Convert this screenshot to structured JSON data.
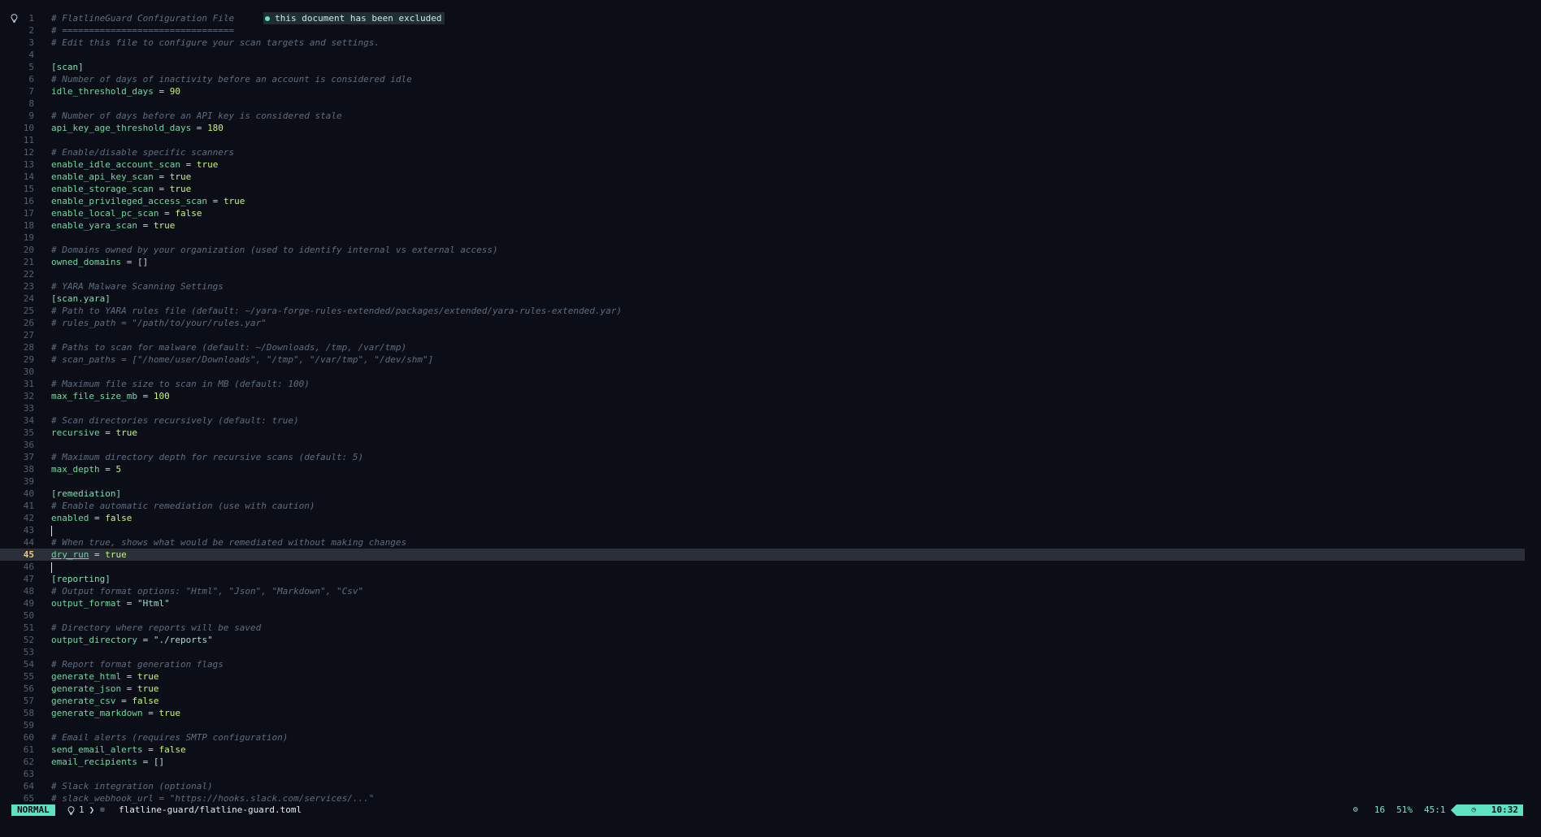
{
  "file": {
    "path": "flatline-guard/flatline-guard.toml",
    "hint": "this document has been excluded",
    "current_line": 45
  },
  "lines": [
    {
      "n": "1",
      "tokens": [
        {
          "t": "comment",
          "v": "# FlatlineGuard Configuration File"
        }
      ]
    },
    {
      "n": "2",
      "tokens": [
        {
          "t": "comment",
          "v": "# ================================"
        }
      ]
    },
    {
      "n": "3",
      "tokens": [
        {
          "t": "comment",
          "v": "# Edit this file to configure your scan targets and settings."
        }
      ]
    },
    {
      "n": "4",
      "tokens": []
    },
    {
      "n": "5",
      "tokens": [
        {
          "t": "section",
          "v": "[scan]"
        }
      ]
    },
    {
      "n": "6",
      "tokens": [
        {
          "t": "comment",
          "v": "# Number of days of inactivity before an account is considered idle"
        }
      ]
    },
    {
      "n": "7",
      "tokens": [
        {
          "t": "key",
          "v": "idle_threshold_days"
        },
        {
          "t": "punc",
          "v": " = "
        },
        {
          "t": "num",
          "v": "90"
        }
      ]
    },
    {
      "n": "8",
      "tokens": []
    },
    {
      "n": "9",
      "tokens": [
        {
          "t": "comment",
          "v": "# Number of days before an API key is considered stale"
        }
      ]
    },
    {
      "n": "10",
      "tokens": [
        {
          "t": "key",
          "v": "api_key_age_threshold_days"
        },
        {
          "t": "punc",
          "v": " = "
        },
        {
          "t": "num",
          "v": "180"
        }
      ]
    },
    {
      "n": "11",
      "tokens": []
    },
    {
      "n": "12",
      "tokens": [
        {
          "t": "comment",
          "v": "# Enable/disable specific scanners"
        }
      ]
    },
    {
      "n": "13",
      "tokens": [
        {
          "t": "key",
          "v": "enable_idle_account_scan"
        },
        {
          "t": "punc",
          "v": " = "
        },
        {
          "t": "bool",
          "v": "true"
        }
      ]
    },
    {
      "n": "14",
      "tokens": [
        {
          "t": "key",
          "v": "enable_api_key_scan"
        },
        {
          "t": "punc",
          "v": " = "
        },
        {
          "t": "bool",
          "v": "true"
        }
      ]
    },
    {
      "n": "15",
      "tokens": [
        {
          "t": "key",
          "v": "enable_storage_scan"
        },
        {
          "t": "punc",
          "v": " = "
        },
        {
          "t": "bool",
          "v": "true"
        }
      ]
    },
    {
      "n": "16",
      "tokens": [
        {
          "t": "key",
          "v": "enable_privileged_access_scan"
        },
        {
          "t": "punc",
          "v": " = "
        },
        {
          "t": "bool",
          "v": "true"
        }
      ]
    },
    {
      "n": "17",
      "tokens": [
        {
          "t": "key",
          "v": "enable_local_pc_scan"
        },
        {
          "t": "punc",
          "v": " = "
        },
        {
          "t": "bool",
          "v": "false"
        }
      ]
    },
    {
      "n": "18",
      "tokens": [
        {
          "t": "key",
          "v": "enable_yara_scan"
        },
        {
          "t": "punc",
          "v": " = "
        },
        {
          "t": "bool",
          "v": "true"
        }
      ]
    },
    {
      "n": "19",
      "tokens": []
    },
    {
      "n": "20",
      "tokens": [
        {
          "t": "comment",
          "v": "# Domains owned by your organization (used to identify internal vs external access)"
        }
      ]
    },
    {
      "n": "21",
      "tokens": [
        {
          "t": "key",
          "v": "owned_domains"
        },
        {
          "t": "punc",
          "v": " = []"
        }
      ]
    },
    {
      "n": "22",
      "tokens": []
    },
    {
      "n": "23",
      "tokens": [
        {
          "t": "comment",
          "v": "# YARA Malware Scanning Settings"
        }
      ]
    },
    {
      "n": "24",
      "tokens": [
        {
          "t": "section",
          "v": "[scan.yara]"
        }
      ]
    },
    {
      "n": "25",
      "tokens": [
        {
          "t": "comment",
          "v": "# Path to YARA rules file (default: ~/yara-forge-rules-extended/packages/extended/yara-rules-extended.yar)"
        }
      ]
    },
    {
      "n": "26",
      "tokens": [
        {
          "t": "comment",
          "v": "# rules_path = \"/path/to/your/rules.yar\""
        }
      ]
    },
    {
      "n": "27",
      "tokens": []
    },
    {
      "n": "28",
      "tokens": [
        {
          "t": "comment",
          "v": "# Paths to scan for malware (default: ~/Downloads, /tmp, /var/tmp)"
        }
      ]
    },
    {
      "n": "29",
      "tokens": [
        {
          "t": "comment",
          "v": "# scan_paths = [\"/home/user/Downloads\", \"/tmp\", \"/var/tmp\", \"/dev/shm\"]"
        }
      ]
    },
    {
      "n": "30",
      "tokens": []
    },
    {
      "n": "31",
      "tokens": [
        {
          "t": "comment",
          "v": "# Maximum file size to scan in MB (default: 100)"
        }
      ]
    },
    {
      "n": "32",
      "tokens": [
        {
          "t": "key",
          "v": "max_file_size_mb"
        },
        {
          "t": "punc",
          "v": " = "
        },
        {
          "t": "num",
          "v": "100"
        }
      ]
    },
    {
      "n": "33",
      "tokens": []
    },
    {
      "n": "34",
      "tokens": [
        {
          "t": "comment",
          "v": "# Scan directories recursively (default: true)"
        }
      ]
    },
    {
      "n": "35",
      "tokens": [
        {
          "t": "key",
          "v": "recursive"
        },
        {
          "t": "punc",
          "v": " = "
        },
        {
          "t": "bool",
          "v": "true"
        }
      ]
    },
    {
      "n": "36",
      "tokens": []
    },
    {
      "n": "37",
      "tokens": [
        {
          "t": "comment",
          "v": "# Maximum directory depth for recursive scans (default: 5)"
        }
      ]
    },
    {
      "n": "38",
      "tokens": [
        {
          "t": "key",
          "v": "max_depth"
        },
        {
          "t": "punc",
          "v": " = "
        },
        {
          "t": "num",
          "v": "5"
        }
      ]
    },
    {
      "n": "39",
      "tokens": []
    },
    {
      "n": "40",
      "tokens": [
        {
          "t": "section",
          "v": "[remediation]"
        }
      ]
    },
    {
      "n": "41",
      "tokens": [
        {
          "t": "comment",
          "v": "# Enable automatic remediation (use with caution)"
        }
      ]
    },
    {
      "n": "42",
      "tokens": [
        {
          "t": "key",
          "v": "enabled"
        },
        {
          "t": "punc",
          "v": " = "
        },
        {
          "t": "bool",
          "v": "false"
        }
      ]
    },
    {
      "n": "43",
      "tokens": [
        {
          "t": "cursor",
          "v": ""
        }
      ]
    },
    {
      "n": "44",
      "tokens": [
        {
          "t": "comment",
          "v": "# When true, shows what would be remediated without making changes"
        }
      ]
    },
    {
      "n": "45",
      "tokens": [
        {
          "t": "key-under",
          "v": "dry_run"
        },
        {
          "t": "punc",
          "v": " = "
        },
        {
          "t": "bool",
          "v": "true"
        }
      ]
    },
    {
      "n": "46",
      "tokens": [
        {
          "t": "cursor",
          "v": ""
        }
      ]
    },
    {
      "n": "47",
      "tokens": [
        {
          "t": "section",
          "v": "[reporting]"
        }
      ]
    },
    {
      "n": "48",
      "tokens": [
        {
          "t": "comment",
          "v": "# Output format options: \"Html\", \"Json\", \"Markdown\", \"Csv\""
        }
      ]
    },
    {
      "n": "49",
      "tokens": [
        {
          "t": "key",
          "v": "output_format"
        },
        {
          "t": "punc",
          "v": " = "
        },
        {
          "t": "str",
          "v": "\"Html\""
        }
      ]
    },
    {
      "n": "50",
      "tokens": []
    },
    {
      "n": "51",
      "tokens": [
        {
          "t": "comment",
          "v": "# Directory where reports will be saved"
        }
      ]
    },
    {
      "n": "52",
      "tokens": [
        {
          "t": "key",
          "v": "output_directory"
        },
        {
          "t": "punc",
          "v": " = "
        },
        {
          "t": "str",
          "v": "\"./reports\""
        }
      ]
    },
    {
      "n": "53",
      "tokens": []
    },
    {
      "n": "54",
      "tokens": [
        {
          "t": "comment",
          "v": "# Report format generation flags"
        }
      ]
    },
    {
      "n": "55",
      "tokens": [
        {
          "t": "key",
          "v": "generate_html"
        },
        {
          "t": "punc",
          "v": " = "
        },
        {
          "t": "bool",
          "v": "true"
        }
      ]
    },
    {
      "n": "56",
      "tokens": [
        {
          "t": "key",
          "v": "generate_json"
        },
        {
          "t": "punc",
          "v": " = "
        },
        {
          "t": "bool",
          "v": "true"
        }
      ]
    },
    {
      "n": "57",
      "tokens": [
        {
          "t": "key",
          "v": "generate_csv"
        },
        {
          "t": "punc",
          "v": " = "
        },
        {
          "t": "bool",
          "v": "false"
        }
      ]
    },
    {
      "n": "58",
      "tokens": [
        {
          "t": "key",
          "v": "generate_markdown"
        },
        {
          "t": "punc",
          "v": " = "
        },
        {
          "t": "bool",
          "v": "true"
        }
      ]
    },
    {
      "n": "59",
      "tokens": []
    },
    {
      "n": "60",
      "tokens": [
        {
          "t": "comment",
          "v": "# Email alerts (requires SMTP configuration)"
        }
      ]
    },
    {
      "n": "61",
      "tokens": [
        {
          "t": "key",
          "v": "send_email_alerts"
        },
        {
          "t": "punc",
          "v": " = "
        },
        {
          "t": "bool",
          "v": "false"
        }
      ]
    },
    {
      "n": "62",
      "tokens": [
        {
          "t": "key",
          "v": "email_recipients"
        },
        {
          "t": "punc",
          "v": " = []"
        }
      ]
    },
    {
      "n": "63",
      "tokens": []
    },
    {
      "n": "64",
      "tokens": [
        {
          "t": "comment",
          "v": "# Slack integration (optional)"
        }
      ]
    },
    {
      "n": "65",
      "tokens": [
        {
          "t": "comment",
          "v": "# slack_webhook_url = \"https://hooks.slack.com/services/...\""
        }
      ]
    }
  ],
  "statusline": {
    "mode": "NORMAL",
    "diagnostics_icon": "lightbulb-icon",
    "diagnostics_count": "1",
    "file_icon": "toml-file-icon",
    "path": "flatline-guard/flatline-guard.toml",
    "lsp_icon": "gear-icon",
    "lsp_count": "16",
    "percent": "51%",
    "position": "45:1",
    "clock_icon": "clock-icon",
    "time": "10:32"
  },
  "colors": {
    "background": "#0b0e17",
    "accent": "#5ee2c4",
    "current_line": "#2a2f3a",
    "line_number_current": "#f2c66d"
  }
}
